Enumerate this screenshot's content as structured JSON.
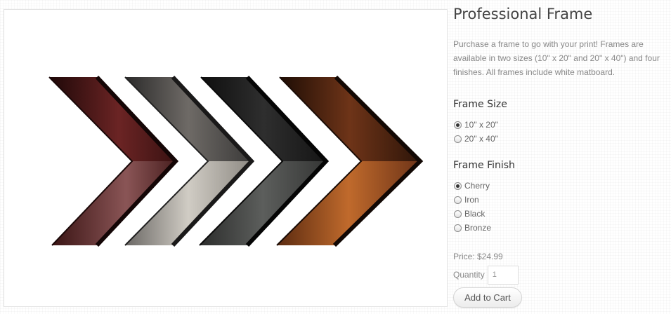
{
  "product": {
    "title": "Professional Frame",
    "description": "Purchase a frame to go with your print! Frames are available in two sizes (10\" x 20\" and 20\" x 40\") and four finishes. All frames include white matboard.",
    "image_alt": "frame-finish-samples"
  },
  "frame_size": {
    "label": "Frame Size",
    "options": [
      {
        "label": "10\" x 20\"",
        "selected": true
      },
      {
        "label": "20\" x 40\"",
        "selected": false
      }
    ]
  },
  "frame_finish": {
    "label": "Frame Finish",
    "options": [
      {
        "label": "Cherry",
        "selected": true
      },
      {
        "label": "Iron",
        "selected": false
      },
      {
        "label": "Black",
        "selected": false
      },
      {
        "label": "Bronze",
        "selected": false
      }
    ]
  },
  "price": {
    "text": "Price: $24.99"
  },
  "quantity": {
    "label": "Quantity",
    "value": "1"
  },
  "add_to_cart_label": "Add to Cart",
  "finish_colors": {
    "cherry": [
      "#2a0e0e",
      "#6b2424",
      "#8a5556"
    ],
    "iron": [
      "#3a3838",
      "#6e6a66",
      "#c9c5bf"
    ],
    "black": [
      "#141414",
      "#2e2e2e",
      "#5c5e5c"
    ],
    "bronze": [
      "#2e1509",
      "#6e3418",
      "#b0622a"
    ]
  }
}
